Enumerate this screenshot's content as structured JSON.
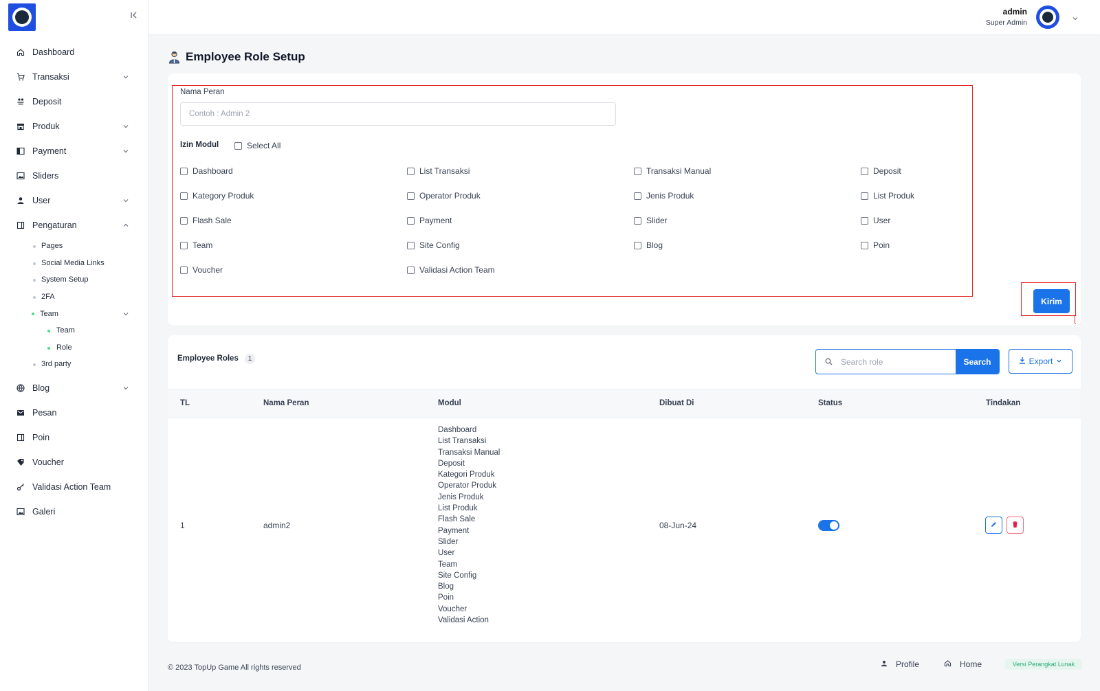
{
  "sidebar": {
    "items": [
      {
        "label": "Dashboard",
        "icon": "home-icon"
      },
      {
        "label": "Transaksi",
        "icon": "cart-icon",
        "expandable": true
      },
      {
        "label": "Deposit",
        "icon": "coins-icon"
      },
      {
        "label": "Produk",
        "icon": "store-icon",
        "expandable": true
      },
      {
        "label": "Payment",
        "icon": "payment-icon",
        "expandable": true
      },
      {
        "label": "Sliders",
        "icon": "image-icon"
      },
      {
        "label": "User",
        "icon": "user-icon",
        "expandable": true
      },
      {
        "label": "Pengaturan",
        "icon": "settings-icon",
        "expanded": true
      }
    ],
    "pengaturan_sub": [
      "Pages",
      "Social Media Links",
      "System Setup",
      "2FA",
      "Team",
      "Team",
      "Role",
      "3rd party"
    ],
    "items_after": [
      {
        "label": "Blog",
        "icon": "blog-icon",
        "expandable": true
      },
      {
        "label": "Pesan",
        "icon": "mail-icon"
      },
      {
        "label": "Poin",
        "icon": "points-icon"
      },
      {
        "label": "Voucher",
        "icon": "voucher-icon"
      },
      {
        "label": "Validasi Action Team",
        "icon": "key-icon"
      },
      {
        "label": "Galeri",
        "icon": "gallery-icon"
      }
    ]
  },
  "header": {
    "user_name": "admin",
    "user_role": "Super Admin"
  },
  "page": {
    "title": "Employee Role Setup"
  },
  "form": {
    "nama_peran_label": "Nama Peran",
    "nama_peran_placeholder": "Contoh : Admin 2",
    "nama_peran_value": "",
    "izin_modul_label": "Izin Modul",
    "select_all_label": "Select All",
    "modules": [
      "Dashboard",
      "List Transaksi",
      "Transaksi Manual",
      "Deposit",
      "Kategory Produk",
      "Operator Produk",
      "Jenis Produk",
      "List Produk",
      "Flash Sale",
      "Payment",
      "Slider",
      "User",
      "Team",
      "Site Config",
      "Blog",
      "Poin",
      "Voucher",
      "Validasi Action Team"
    ],
    "submit_label": "Kirim"
  },
  "table": {
    "title": "Employee Roles",
    "count": "1",
    "search_placeholder": "Search role",
    "search_button": "Search",
    "export_button": "Export",
    "columns": [
      "TL",
      "Nama Peran",
      "Modul",
      "Dibuat Di",
      "Status",
      "Tindakan"
    ],
    "rows": [
      {
        "tl": "1",
        "nama_peran": "admin2",
        "modul": "Dashboard\nList Transaksi\nTransaksi Manual\nDeposit\nKategori Produk\nOperator Produk\nJenis Produk\nList Produk\nFlash Sale\nPayment\nSlider\nUser\nTeam\nSite Config\nBlog\nPoin\nVoucher\nValidasi Action",
        "dibuat_di": "08-Jun-24",
        "status_active": true
      }
    ]
  },
  "footer": {
    "copyright": "© 2023 TopUp Game All rights reserved",
    "profile_link": "Profile",
    "home_link": "Home",
    "version_badge": "Versi Perangkat Lunak"
  },
  "colors": {
    "primary": "#1a73e8",
    "highlight": "#e02424",
    "logo_bg": "#1f4fe0",
    "sub_active_dot": "#4ade80",
    "delete": "#e11d48"
  }
}
